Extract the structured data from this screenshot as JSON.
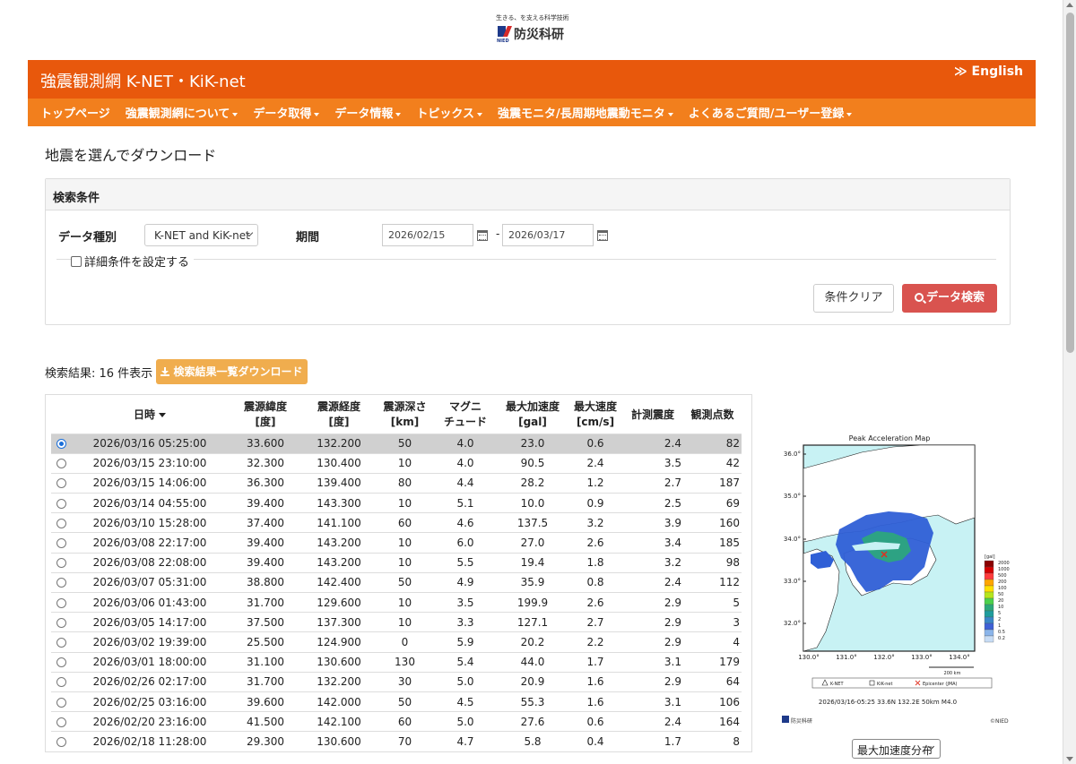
{
  "logo": {
    "tagline": "生きる、を支える科学技術",
    "name": "防災科研",
    "abbr": "NIED"
  },
  "header": {
    "title": "強震観測網 K-NET・KiK-net",
    "lang_link": "≫ English"
  },
  "nav": [
    {
      "label": "トップページ",
      "dropdown": false
    },
    {
      "label": "強震観測網について",
      "dropdown": true
    },
    {
      "label": "データ取得",
      "dropdown": true
    },
    {
      "label": "データ情報",
      "dropdown": true
    },
    {
      "label": "トピックス",
      "dropdown": true
    },
    {
      "label": "強震モニタ/長周期地震動モニタ",
      "dropdown": true
    },
    {
      "label": "よくあるご質問/ユーザー登録",
      "dropdown": true
    }
  ],
  "page_title": "地震を選んでダウンロード",
  "search": {
    "panel_title": "検索条件",
    "data_type_label": "データ種別",
    "data_type_value": "K-NET and KiK-net",
    "period_label": "期間",
    "date_from": "2026/02/15",
    "date_to": "2026/03/17",
    "date_sep": "-",
    "advanced_label": "詳細条件を設定する",
    "clear_button": "条件クリア",
    "search_button": "データ検索"
  },
  "results": {
    "count_text": "検索結果: 16 件表示",
    "download_button": "検索結果一覧ダウンロード"
  },
  "table": {
    "headers": {
      "datetime": "日時",
      "lat": [
        "震源緯度",
        "[度]"
      ],
      "lon": [
        "震源経度",
        "[度]"
      ],
      "depth": [
        "震源深さ",
        "[km]"
      ],
      "mag": [
        "マグニ",
        "チュード"
      ],
      "pga": [
        "最大加速度",
        "[gal]"
      ],
      "pgv": [
        "最大速度",
        "[cm/s]"
      ],
      "intensity": [
        "計測震度",
        ""
      ],
      "stations": [
        "観測点数",
        ""
      ]
    },
    "selected_index": 0,
    "rows": [
      [
        "2026/03/16 05:25:00",
        "33.600",
        "132.200",
        "50",
        "4.0",
        "23.0",
        "0.6",
        "2.4",
        "82"
      ],
      [
        "2026/03/15 23:10:00",
        "32.300",
        "130.400",
        "10",
        "4.0",
        "90.5",
        "2.4",
        "3.5",
        "42"
      ],
      [
        "2026/03/15 14:06:00",
        "36.300",
        "139.400",
        "80",
        "4.4",
        "28.2",
        "1.2",
        "2.7",
        "187"
      ],
      [
        "2026/03/14 04:55:00",
        "39.400",
        "143.300",
        "10",
        "5.1",
        "10.0",
        "0.9",
        "2.5",
        "69"
      ],
      [
        "2026/03/10 15:28:00",
        "37.400",
        "141.100",
        "60",
        "4.6",
        "137.5",
        "3.2",
        "3.9",
        "160"
      ],
      [
        "2026/03/08 22:17:00",
        "39.400",
        "143.200",
        "10",
        "6.0",
        "27.0",
        "2.6",
        "3.4",
        "185"
      ],
      [
        "2026/03/08 22:08:00",
        "39.400",
        "143.200",
        "10",
        "5.5",
        "19.4",
        "1.8",
        "3.2",
        "98"
      ],
      [
        "2026/03/07 05:31:00",
        "38.800",
        "142.400",
        "50",
        "4.9",
        "35.9",
        "0.8",
        "2.4",
        "112"
      ],
      [
        "2026/03/06 01:43:00",
        "31.700",
        "129.600",
        "10",
        "3.5",
        "199.9",
        "2.6",
        "2.9",
        "5"
      ],
      [
        "2026/03/05 14:17:00",
        "37.500",
        "137.300",
        "10",
        "3.3",
        "127.1",
        "2.7",
        "2.9",
        "3"
      ],
      [
        "2026/03/02 19:39:00",
        "25.500",
        "124.900",
        "0",
        "5.9",
        "20.2",
        "2.2",
        "2.9",
        "4"
      ],
      [
        "2026/03/01 18:00:00",
        "31.100",
        "130.600",
        "130",
        "5.4",
        "44.0",
        "1.7",
        "3.1",
        "179"
      ],
      [
        "2026/02/26 02:17:00",
        "31.700",
        "132.200",
        "30",
        "5.0",
        "20.9",
        "1.6",
        "2.9",
        "64"
      ],
      [
        "2026/02/25 03:16:00",
        "39.600",
        "142.000",
        "50",
        "4.5",
        "55.3",
        "1.6",
        "3.1",
        "106"
      ],
      [
        "2026/02/20 23:16:00",
        "41.500",
        "142.100",
        "60",
        "5.0",
        "27.6",
        "0.6",
        "2.4",
        "164"
      ],
      [
        "2026/02/18 11:28:00",
        "29.300",
        "130.600",
        "70",
        "4.7",
        "5.8",
        "0.4",
        "1.7",
        "8"
      ]
    ]
  },
  "map": {
    "title": "Peak Acceleration Map",
    "lat_ticks": [
      "36.0°",
      "35.0°",
      "34.0°",
      "33.0°",
      "32.0°"
    ],
    "lon_ticks": [
      "130.0°",
      "131.0°",
      "132.0°",
      "133.0°",
      "134.0°"
    ],
    "scale_label": "200 km",
    "legend_unit": "[gal]",
    "legend_values": [
      "2000",
      "1000",
      "500",
      "200",
      "100",
      "50",
      "20",
      "10",
      "5",
      "2",
      "1",
      "0.5",
      "0.2"
    ],
    "legend_colors": [
      "#8b0000",
      "#d40000",
      "#ff3c3c",
      "#ffa500",
      "#ffe000",
      "#b5e61d",
      "#4cd14c",
      "#2ca87a",
      "#1f9c9c",
      "#3a86c8",
      "#3f61d6",
      "#8ab4ea",
      "#c7dcf5"
    ],
    "symbol_legend": [
      "K-NET",
      "KiK-net",
      "Epicenter (JMA)"
    ],
    "caption": "2026/03/16-05:25 33.6N 132.2E 50km M4.0",
    "credit_left": "防災科研",
    "credit_right": "©NIED",
    "colors": {
      "sea": "#c8f2f4",
      "land": "#ffffff",
      "low": "#2f5fd6",
      "mid": "#2ca87a",
      "epicenter": "#e03020"
    }
  },
  "map_select": "最大加速度分布",
  "colors": {
    "header_dark": "#e8580c",
    "header_nav": "#f27f1d",
    "search_btn": "#d9534f",
    "download_btn": "#f0ad4e"
  }
}
